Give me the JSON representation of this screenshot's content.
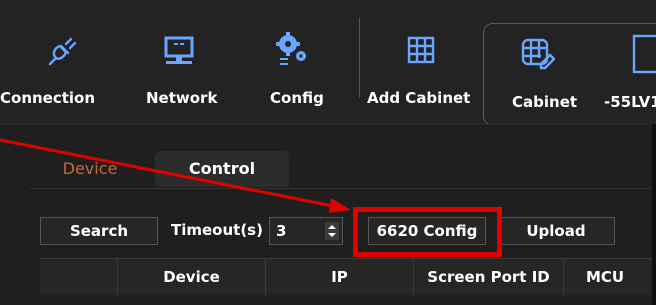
{
  "toolbar": {
    "items": [
      {
        "label": "Connection",
        "icon": "plug-icon"
      },
      {
        "label": "Network",
        "icon": "monitor-icon"
      },
      {
        "label": "Config",
        "icon": "gears-icon"
      },
      {
        "label": "Add Cabinet",
        "icon": "grid-icon"
      },
      {
        "label": "Cabinet",
        "icon": "grid-edit-icon"
      },
      {
        "label": "-55LV1",
        "icon": "panel-icon"
      }
    ]
  },
  "tabs": [
    {
      "label": "Device",
      "active": true
    },
    {
      "label": "Control",
      "active": false
    }
  ],
  "controls": {
    "search_label": "Search",
    "timeout_label": "Timeout(s)",
    "timeout_value": "3",
    "config_6620_label": "6620 Config",
    "upload_label": "Upload"
  },
  "table": {
    "columns": [
      "",
      "Device",
      "IP",
      "Screen Port ID",
      "MCU"
    ]
  },
  "colors": {
    "accent": "#c8693a",
    "icon_blue": "#6aa6ff",
    "highlight": "#e00000"
  }
}
